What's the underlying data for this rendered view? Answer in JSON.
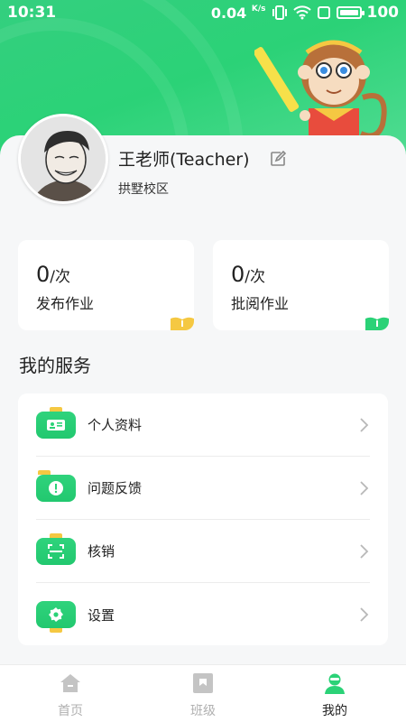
{
  "status_bar": {
    "time": "10:31",
    "net_speed": "0.04",
    "net_unit": "K/s",
    "battery": "100"
  },
  "profile": {
    "name": "王老师(Teacher)",
    "campus": "拱墅校区"
  },
  "stats": [
    {
      "count": "0",
      "unit": "/次",
      "label": "发布作业"
    },
    {
      "count": "0",
      "unit": "/次",
      "label": "批阅作业"
    }
  ],
  "services": {
    "title": "我的服务",
    "items": [
      {
        "label": "个人资料",
        "icon": "id-card-icon"
      },
      {
        "label": "问题反馈",
        "icon": "alert-icon"
      },
      {
        "label": "核销",
        "icon": "scan-icon"
      },
      {
        "label": "设置",
        "icon": "gear-icon"
      }
    ]
  },
  "tabbar": {
    "items": [
      {
        "label": "首页",
        "icon": "home-icon"
      },
      {
        "label": "班级",
        "icon": "class-icon"
      },
      {
        "label": "我的",
        "icon": "profile-icon"
      }
    ],
    "active_index": 2
  },
  "colors": {
    "brand_green": "#2bd277",
    "inactive": "#b0b0b0",
    "accent_yellow": "#f5c842"
  }
}
